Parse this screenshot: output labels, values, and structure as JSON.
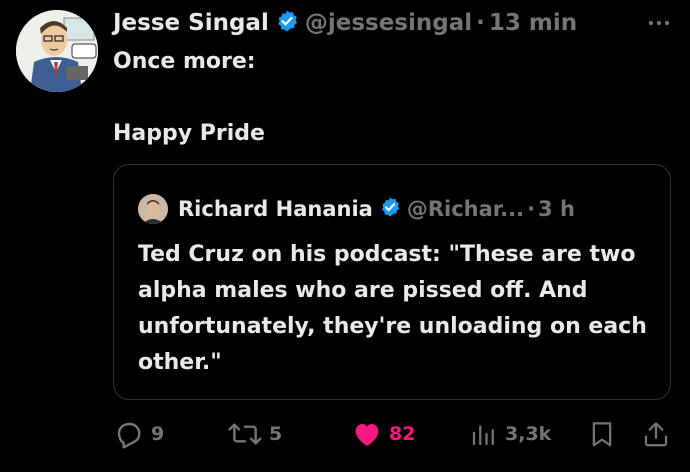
{
  "author": {
    "name": "Jesse Singal",
    "handle": "@jessesingal",
    "separator": "·",
    "time": "13 min"
  },
  "tweet": {
    "text": "Once more:\n\nHappy Pride"
  },
  "quoted": {
    "name": "Richard Hanania",
    "handle": "@Richar...",
    "separator": "·",
    "time": "3 h",
    "text": "Ted Cruz on his podcast: \"These are two alpha males who are pissed off. And unfortunately, they're unloading on each other.\""
  },
  "actions": {
    "replies": "9",
    "retweets": "5",
    "likes": "82",
    "views": "3,3k"
  },
  "colors": {
    "background": "#000000",
    "verified": "#1d9bf0",
    "like": "#f91880",
    "muted": "#71767b"
  },
  "icons": [
    "more-icon",
    "verified-icon",
    "reply-icon",
    "retweet-icon",
    "heart-icon",
    "views-icon",
    "bookmark-icon",
    "share-icon"
  ]
}
